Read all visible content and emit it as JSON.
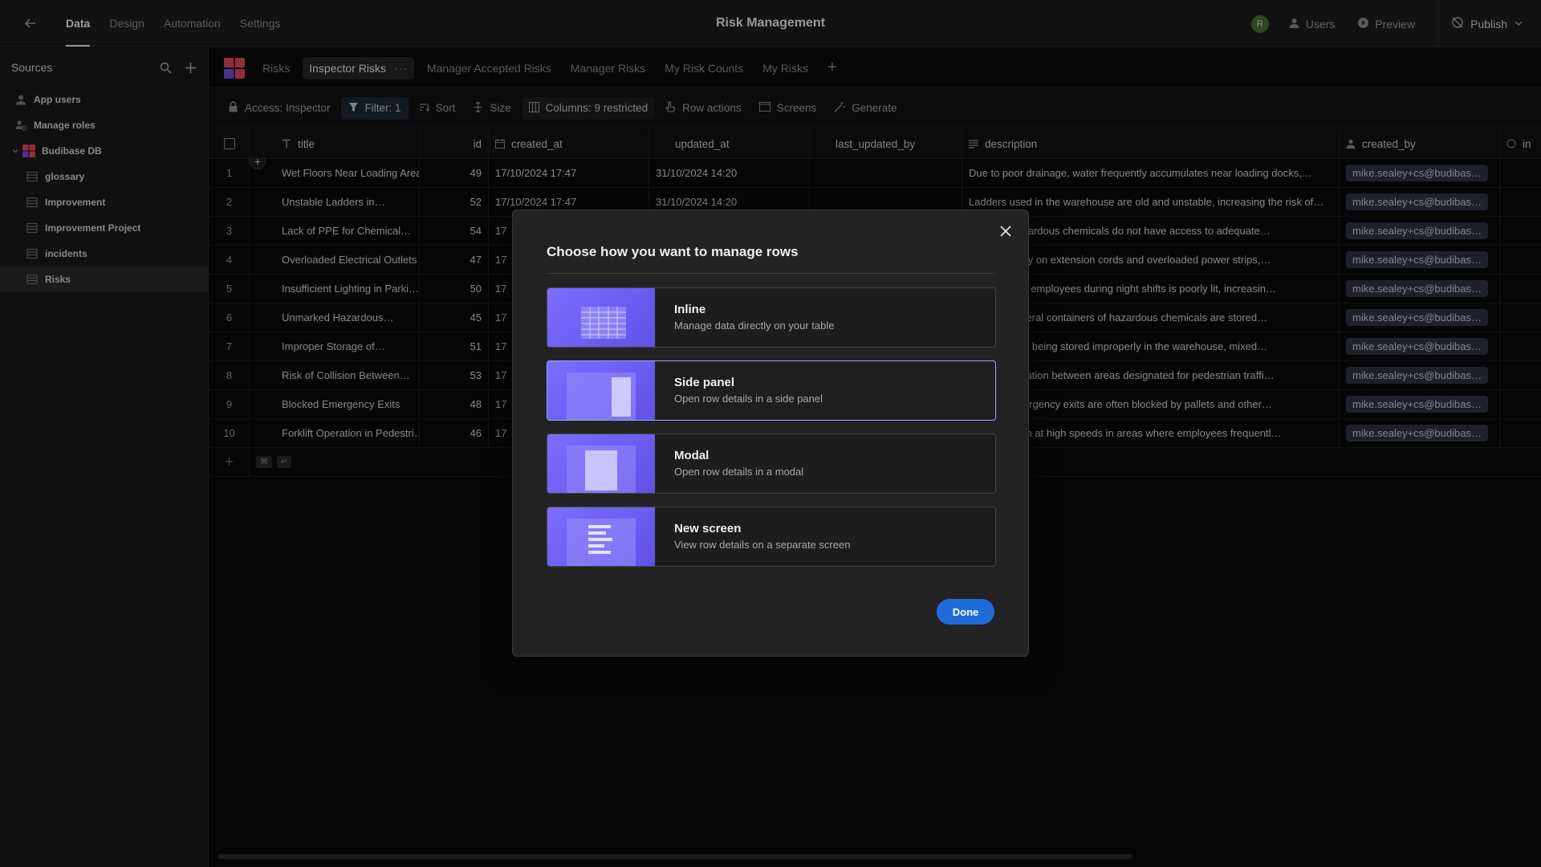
{
  "app": {
    "title": "Risk Management",
    "nav": [
      "Data",
      "Design",
      "Automation",
      "Settings"
    ],
    "active_nav": "Data",
    "avatar_initial": "R",
    "users_label": "Users",
    "preview_label": "Preview",
    "publish_label": "Publish"
  },
  "sidebar": {
    "heading": "Sources",
    "items": [
      {
        "label": "App users",
        "icon": "user-icon"
      },
      {
        "label": "Manage roles",
        "icon": "roles-icon"
      },
      {
        "label": "Budibase DB",
        "icon": "budibase-db-icon"
      },
      {
        "label": "glossary",
        "icon": "table-icon"
      },
      {
        "label": "Improvement",
        "icon": "table-icon"
      },
      {
        "label": "Improvement Project",
        "icon": "table-icon"
      },
      {
        "label": "incidents",
        "icon": "table-icon"
      },
      {
        "label": "Risks",
        "icon": "table-icon"
      }
    ]
  },
  "tabs": [
    "Risks",
    "Inspector Risks",
    "Manager Accepted Risks",
    "Manager Risks",
    "My Risk Counts",
    "My Risks"
  ],
  "active_tab": "Inspector Risks",
  "toolbar": {
    "access": "Access: Inspector",
    "filter": "Filter: 1",
    "sort": "Sort",
    "size": "Size",
    "columns": "Columns: 9 restricted",
    "row_actions": "Row actions",
    "screens": "Screens",
    "generate": "Generate"
  },
  "grid": {
    "columns": [
      "title",
      "id",
      "created_at",
      "updated_at",
      "last_updated_by",
      "description",
      "created_by",
      "in"
    ],
    "rows": [
      {
        "n": "1",
        "title": "Wet Floors Near Loading Areas",
        "id": "49",
        "created": "17/10/2024 17:47",
        "updated": "31/10/2024 14:20",
        "desc": "Due to poor drainage, water frequently accumulates near loading docks,…",
        "created_by": "mike.sealey+cs@budibas…"
      },
      {
        "n": "2",
        "title": "Unstable Ladders in…",
        "id": "52",
        "created": "17/10/2024 17:47",
        "updated": "31/10/2024 14:20",
        "desc": "Ladders used in the warehouse are old and unstable, increasing the risk of…",
        "created_by": "mike.sealey+cs@budibas…"
      },
      {
        "n": "3",
        "title": "Lack of PPE for Chemical…",
        "id": "54",
        "created": "17",
        "updated": "",
        "desc": "handling hazardous chemicals do not have access to adequate…",
        "created_by": "mike.sealey+cs@budibas…"
      },
      {
        "n": "4",
        "title": "Overloaded Electrical Outlets",
        "id": "47",
        "created": "17",
        "updated": "",
        "desc": "rkstations rely on extension cords and overloaded power strips,…",
        "created_by": "mike.sealey+cs@budibas…"
      },
      {
        "n": "5",
        "title": "Insufficient Lighting in Parki…",
        "id": "50",
        "created": "17",
        "updated": "",
        "desc": "g lot used by employees during night shifts is poorly lit, increasin…",
        "created_by": "mike.sealey+cs@budibas…"
      },
      {
        "n": "6",
        "title": "Unmarked Hazardous…",
        "id": "45",
        "created": "17",
        "updated": "",
        "desc": "ge area, several containers of hazardous chemicals are stored…",
        "created_by": "mike.sealey+cs@budibas…"
      },
      {
        "n": "7",
        "title": "Improper Storage of…",
        "id": "51",
        "created": "17",
        "updated": "",
        "desc": "materials are being stored improperly in the warehouse, mixed…",
        "created_by": "mike.sealey+cs@budibas…"
      },
      {
        "n": "8",
        "title": "Risk of Collision Between…",
        "id": "53",
        "created": "17",
        "updated": "",
        "desc": "clear segregation between areas designated for pedestrian traffi…",
        "created_by": "mike.sealey+cs@budibas…"
      },
      {
        "n": "9",
        "title": "Blocked Emergency Exits",
        "id": "48",
        "created": "17",
        "updated": "",
        "desc": "k hours, emergency exits are often blocked by pallets and other…",
        "created_by": "mike.sealey+cs@budibas…"
      },
      {
        "n": "10",
        "title": "Forklift Operation in Pedestri…",
        "id": "46",
        "created": "17",
        "updated": "",
        "desc": "e often driven at high speeds in areas where employees frequentl…",
        "created_by": "mike.sealey+cs@budibas…"
      }
    ]
  },
  "modal": {
    "title": "Choose how you want to manage rows",
    "options": [
      {
        "name": "Inline",
        "desc": "Manage data directly on your table",
        "icon": "inline-table-illustration"
      },
      {
        "name": "Side panel",
        "desc": "Open row details in a side panel",
        "icon": "side-panel-illustration"
      },
      {
        "name": "Modal",
        "desc": "Open row details in a modal",
        "icon": "modal-illustration"
      },
      {
        "name": "New screen",
        "desc": "View row details on a separate screen",
        "icon": "new-screen-illustration"
      }
    ],
    "selected": "Side panel",
    "done_label": "Done"
  },
  "colors": {
    "accent": "#1e6cd9",
    "option_thumb": "#7161ff",
    "selected_border": "#9aa4ff"
  }
}
